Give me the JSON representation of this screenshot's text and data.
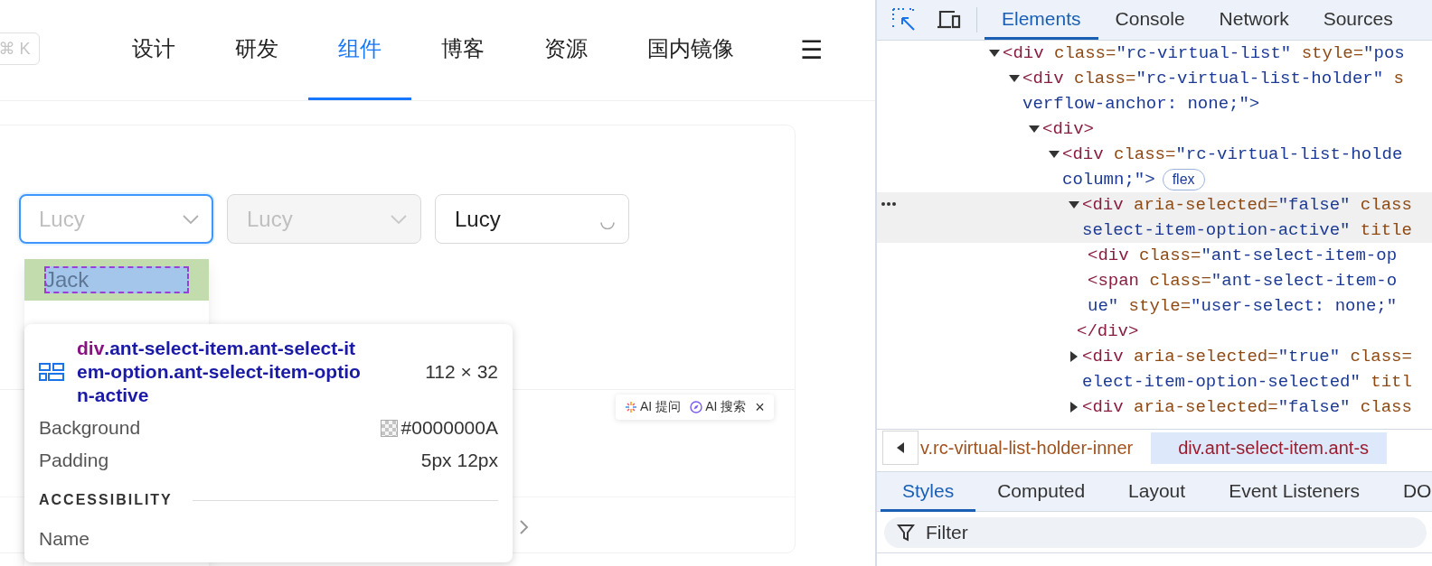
{
  "header": {
    "shortcut": "⌘ K",
    "nav": [
      {
        "label": "设计",
        "selected": false
      },
      {
        "label": "研发",
        "selected": false
      },
      {
        "label": "组件",
        "selected": true
      },
      {
        "label": "博客",
        "selected": false
      },
      {
        "label": "资源",
        "selected": false
      },
      {
        "label": "国内镜像",
        "selected": false
      }
    ],
    "menu": "☰"
  },
  "demo": {
    "selects": [
      {
        "placeholder": "Lucy",
        "focused": true,
        "disabled": false,
        "loading": false
      },
      {
        "placeholder": "Lucy",
        "focused": false,
        "disabled": true,
        "loading": false
      },
      {
        "value": "Lucy",
        "focused": false,
        "disabled": false,
        "loading": true
      }
    ],
    "dropdown": {
      "options": [
        {
          "label": "Jack",
          "highlighted": true
        }
      ]
    },
    "inspect_tooltip": {
      "tag": "div",
      "classes": ".ant-select-item.ant-select-item-option.ant-select-item-option-active",
      "size": "112 × 32",
      "properties": [
        {
          "kind": "color",
          "label": "Background",
          "value": "#0000000A"
        },
        {
          "kind": "text",
          "label": "Padding",
          "value": "5px 12px"
        }
      ],
      "section": "ACCESSIBILITY",
      "section_rows": [
        "Name"
      ]
    },
    "ai_bar": {
      "items": [
        "AI 提问",
        "AI 搜索"
      ],
      "close": "×"
    }
  },
  "devtools": {
    "tabs": [
      {
        "label": "Elements",
        "selected": true
      },
      {
        "label": "Console",
        "selected": false
      },
      {
        "label": "Network",
        "selected": false
      },
      {
        "label": "Sources",
        "selected": false
      }
    ],
    "dom_tree": [
      {
        "expanded": true,
        "selected": false,
        "lines": [
          [
            {
              "kind": "tag",
              "text": "<div"
            },
            {
              "kind": "attr",
              "text": " class="
            },
            {
              "kind": "value",
              "text": "\"rc-virtual-list\""
            },
            {
              "kind": "attr",
              "text": " style="
            },
            {
              "kind": "value",
              "text": "\"pos"
            }
          ]
        ],
        "children": [
          {
            "expanded": true,
            "selected": false,
            "lines": [
              [
                {
                  "kind": "tag",
                  "text": "<div"
                },
                {
                  "kind": "attr",
                  "text": " class="
                },
                {
                  "kind": "value",
                  "text": "\"rc-virtual-list-holder\""
                },
                {
                  "kind": "attr",
                  "text": " s"
                }
              ],
              [
                {
                  "kind": "value",
                  "text": "verflow-anchor: none;\">"
                }
              ]
            ],
            "children": [
              {
                "expanded": true,
                "selected": false,
                "lines": [
                  [
                    {
                      "kind": "tag",
                      "text": "<div>"
                    }
                  ]
                ],
                "children": [
                  {
                    "expanded": true,
                    "selected": false,
                    "badge": "flex",
                    "lines": [
                      [
                        {
                          "kind": "tag",
                          "text": "<div"
                        },
                        {
                          "kind": "attr",
                          "text": " class="
                        },
                        {
                          "kind": "value",
                          "text": "\"rc-virtual-list-holde"
                        }
                      ],
                      [
                        {
                          "kind": "value",
                          "text": "column;\">"
                        }
                      ]
                    ],
                    "children": [
                      {
                        "expanded": true,
                        "selected": true,
                        "lines": [
                          [
                            {
                              "kind": "tag",
                              "text": "<div"
                            },
                            {
                              "kind": "attr",
                              "text": " aria-selected="
                            },
                            {
                              "kind": "value",
                              "text": "\"false\""
                            },
                            {
                              "kind": "attr",
                              "text": " class"
                            }
                          ],
                          [
                            {
                              "kind": "value",
                              "text": "select-item-option-active\""
                            },
                            {
                              "kind": "attr",
                              "text": " title"
                            }
                          ]
                        ],
                        "children": [
                          {
                            "selected": false,
                            "lines": [
                              [
                                {
                                  "kind": "tag",
                                  "text": "<div"
                                },
                                {
                                  "kind": "attr",
                                  "text": " class="
                                },
                                {
                                  "kind": "value",
                                  "text": "\"ant-select-item-op"
                                }
                              ]
                            ]
                          },
                          {
                            "selected": false,
                            "lines": [
                              [
                                {
                                  "kind": "tag",
                                  "text": "<span"
                                },
                                {
                                  "kind": "attr",
                                  "text": " class="
                                },
                                {
                                  "kind": "value",
                                  "text": "\"ant-select-item-o"
                                }
                              ],
                              [
                                {
                                  "kind": "value",
                                  "text": "ue\""
                                },
                                {
                                  "kind": "attr",
                                  "text": " style="
                                },
                                {
                                  "kind": "value",
                                  "text": "\"user-select: none;\""
                                }
                              ]
                            ]
                          }
                        ],
                        "close": [
                          {
                            "kind": "tag",
                            "text": "</div>"
                          }
                        ]
                      },
                      {
                        "expanded": false,
                        "selected": false,
                        "lines": [
                          [
                            {
                              "kind": "tag",
                              "text": "<div"
                            },
                            {
                              "kind": "attr",
                              "text": " aria-selected="
                            },
                            {
                              "kind": "value",
                              "text": "\"true\""
                            },
                            {
                              "kind": "attr",
                              "text": " class="
                            }
                          ],
                          [
                            {
                              "kind": "value",
                              "text": "elect-item-option-selected\""
                            },
                            {
                              "kind": "attr",
                              "text": " titl"
                            }
                          ]
                        ]
                      },
                      {
                        "expanded": false,
                        "selected": false,
                        "lines": [
                          [
                            {
                              "kind": "tag",
                              "text": "<div"
                            },
                            {
                              "kind": "attr",
                              "text": " aria-selected="
                            },
                            {
                              "kind": "value",
                              "text": "\"false\""
                            },
                            {
                              "kind": "attr",
                              "text": " class"
                            }
                          ]
                        ]
                      }
                    ]
                  }
                ]
              }
            ]
          }
        ]
      }
    ],
    "breadcrumbs": [
      {
        "label": "v.rc-virtual-list-holder-inner",
        "selected": false
      },
      {
        "label": "div.ant-select-item.ant-s",
        "selected": true
      }
    ],
    "panel_tabs": [
      {
        "label": "Styles",
        "selected": true
      },
      {
        "label": "Computed",
        "selected": false
      },
      {
        "label": "Layout",
        "selected": false
      },
      {
        "label": "Event Listeners",
        "selected": false
      },
      {
        "label": "DO",
        "selected": false
      }
    ],
    "filter": {
      "placeholder": "Filter"
    }
  }
}
